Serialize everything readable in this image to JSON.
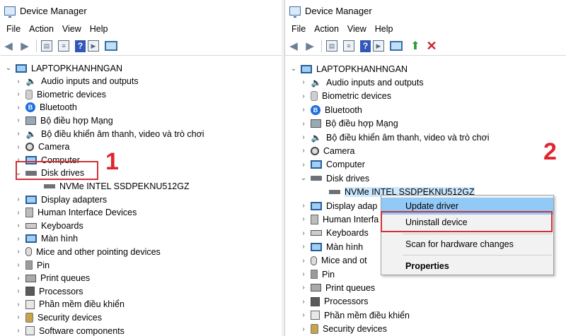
{
  "left": {
    "title": "Device Manager",
    "menu": [
      "File",
      "Action",
      "View",
      "Help"
    ],
    "root": "LAPTOPKHANHNGAN",
    "items": [
      {
        "label": "Audio inputs and outputs",
        "icon": "speaker-icon",
        "expanded": false
      },
      {
        "label": "Biometric devices",
        "icon": "biometric-icon",
        "expanded": false
      },
      {
        "label": "Bluetooth",
        "icon": "bluetooth-icon",
        "expanded": false
      },
      {
        "label": "Bộ điều hợp Mạng",
        "icon": "network-adapter-icon",
        "expanded": false
      },
      {
        "label": "Bộ điều khiển âm thanh, video và trò chơi",
        "icon": "speaker-icon",
        "expanded": false
      },
      {
        "label": "Camera",
        "icon": "camera-icon",
        "expanded": false
      },
      {
        "label": "Computer",
        "icon": "computer-icon",
        "expanded": false
      },
      {
        "label": "Disk drives",
        "icon": "disk-drive-icon",
        "expanded": true
      },
      {
        "label": "NVMe INTEL SSDPEKNU512GZ",
        "icon": "disk-drive-icon",
        "child": true
      },
      {
        "label": "Display adapters",
        "icon": "display-adapter-icon",
        "expanded": false
      },
      {
        "label": "Human Interface Devices",
        "icon": "hid-icon",
        "expanded": false
      },
      {
        "label": "Keyboards",
        "icon": "keyboard-icon",
        "expanded": false
      },
      {
        "label": "Màn hình",
        "icon": "monitor-icon",
        "expanded": false
      },
      {
        "label": "Mice and other pointing devices",
        "icon": "mouse-icon",
        "expanded": false
      },
      {
        "label": "Pin",
        "icon": "battery-icon",
        "expanded": false
      },
      {
        "label": "Print queues",
        "icon": "printer-icon",
        "expanded": false
      },
      {
        "label": "Processors",
        "icon": "processor-icon",
        "expanded": false
      },
      {
        "label": "Phần mềm điều khiển",
        "icon": "software-icon",
        "expanded": false
      },
      {
        "label": "Security devices",
        "icon": "security-icon",
        "expanded": false
      },
      {
        "label": "Software components",
        "icon": "software-icon",
        "expanded": false
      }
    ],
    "callout": "1"
  },
  "right": {
    "title": "Device Manager",
    "menu": [
      "File",
      "Action",
      "View",
      "Help"
    ],
    "root": "LAPTOPKHANHNGAN",
    "items": [
      {
        "label": "Audio inputs and outputs",
        "icon": "speaker-icon",
        "expanded": false
      },
      {
        "label": "Biometric devices",
        "icon": "biometric-icon",
        "expanded": false
      },
      {
        "label": "Bluetooth",
        "icon": "bluetooth-icon",
        "expanded": false
      },
      {
        "label": "Bộ điều hợp Mạng",
        "icon": "network-adapter-icon",
        "expanded": false
      },
      {
        "label": "Bộ điều khiển âm thanh, video và trò chơi",
        "icon": "speaker-icon",
        "expanded": false
      },
      {
        "label": "Camera",
        "icon": "camera-icon",
        "expanded": false
      },
      {
        "label": "Computer",
        "icon": "computer-icon",
        "expanded": false
      },
      {
        "label": "Disk drives",
        "icon": "disk-drive-icon",
        "expanded": true
      },
      {
        "label": "NVMe INTEL SSDPEKNU512GZ",
        "icon": "disk-drive-icon",
        "child": true,
        "selected": true
      },
      {
        "label": "Display adap",
        "icon": "display-adapter-icon",
        "expanded": false
      },
      {
        "label": "Human Interfa",
        "icon": "hid-icon",
        "expanded": false
      },
      {
        "label": "Keyboards",
        "icon": "keyboard-icon",
        "expanded": false
      },
      {
        "label": "Màn hình",
        "icon": "monitor-icon",
        "expanded": false
      },
      {
        "label": "Mice and ot",
        "icon": "mouse-icon",
        "expanded": false
      },
      {
        "label": "Pin",
        "icon": "battery-icon",
        "expanded": false
      },
      {
        "label": "Print queues",
        "icon": "printer-icon",
        "expanded": false
      },
      {
        "label": "Processors",
        "icon": "processor-icon",
        "expanded": false
      },
      {
        "label": "Phần mềm điều khiển",
        "icon": "software-icon",
        "expanded": false
      },
      {
        "label": "Security devices",
        "icon": "security-icon",
        "expanded": false
      }
    ],
    "callout": "2",
    "context_menu": [
      {
        "label": "Update driver",
        "highlighted": true
      },
      {
        "label": "Uninstall device",
        "boxed": true
      },
      {
        "separator": true
      },
      {
        "label": "Scan for hardware changes"
      },
      {
        "separator": true
      },
      {
        "label": "Properties",
        "bold": true
      }
    ]
  },
  "colors": {
    "callout_red": "#e0252d",
    "highlight_box": "#d03238",
    "menu_highlight": "#91c9f7",
    "selection": "#cce8ff"
  }
}
